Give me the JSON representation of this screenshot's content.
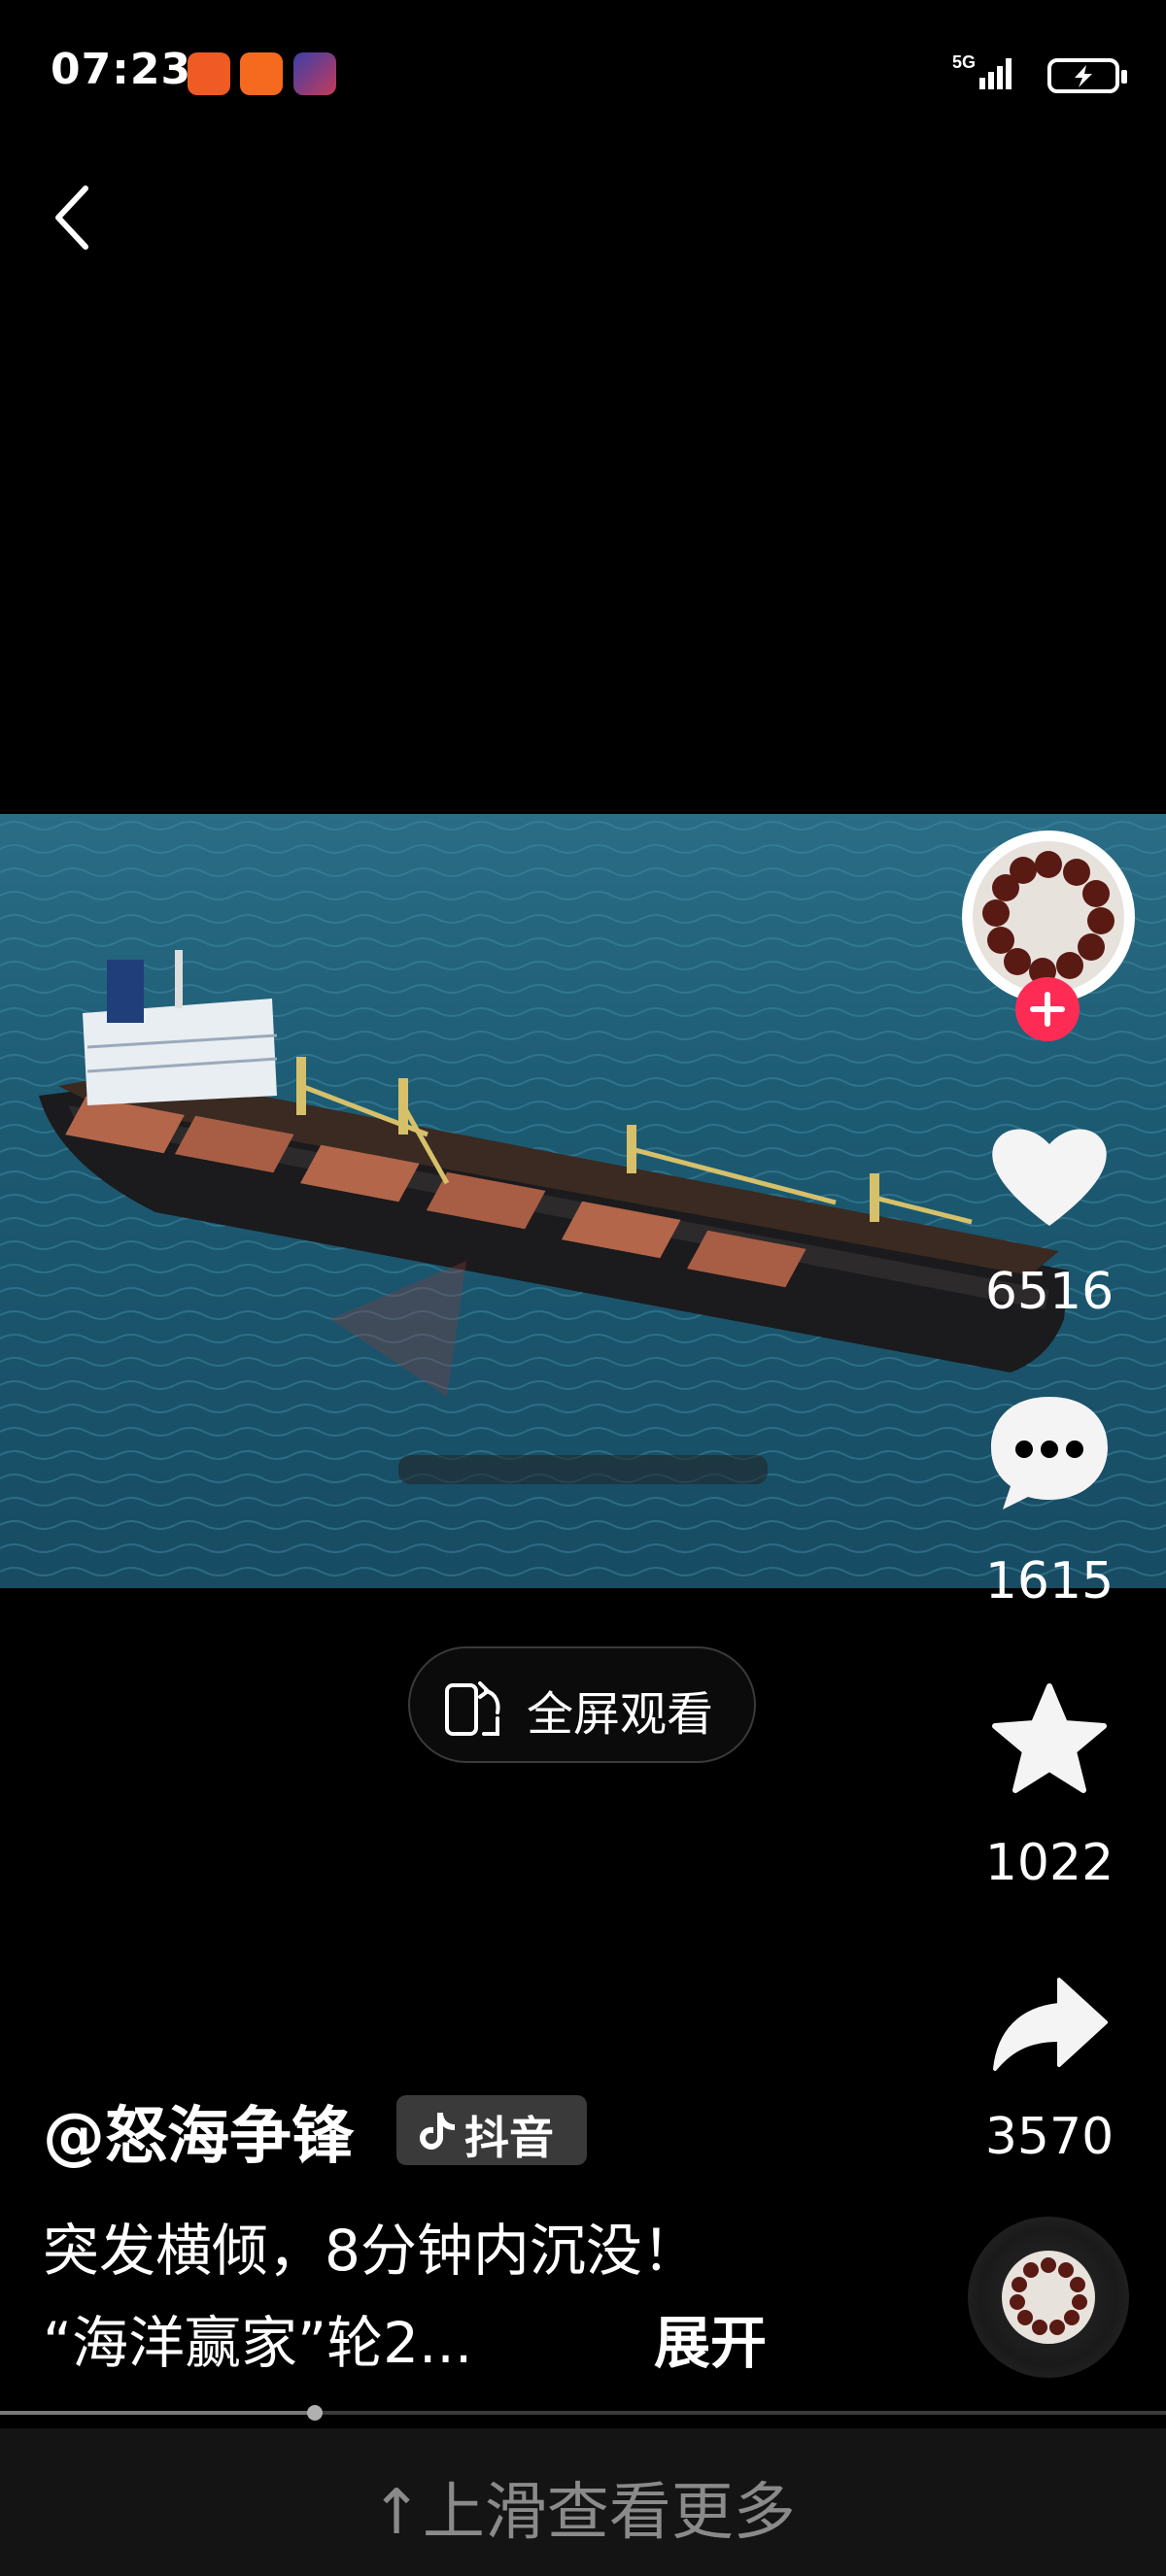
{
  "status_bar": {
    "time": "07:23",
    "network": "5G"
  },
  "fullscreen": {
    "label": "全屏观看"
  },
  "rail": {
    "likes": "6516",
    "comments": "1615",
    "favorites": "1022",
    "shares": "3570"
  },
  "post": {
    "author": "@怒海争锋",
    "platform_badge": "抖音",
    "desc_line1": "突发横倾，8分钟内沉没！",
    "desc_line2": "“海洋赢家”轮2...",
    "expand_label": "展开"
  },
  "playback": {
    "progress": 0.27
  },
  "footer": {
    "swipe_hint": "↑上滑查看更多"
  },
  "colors": {
    "accent": "#fe2c55",
    "background": "#000000"
  }
}
